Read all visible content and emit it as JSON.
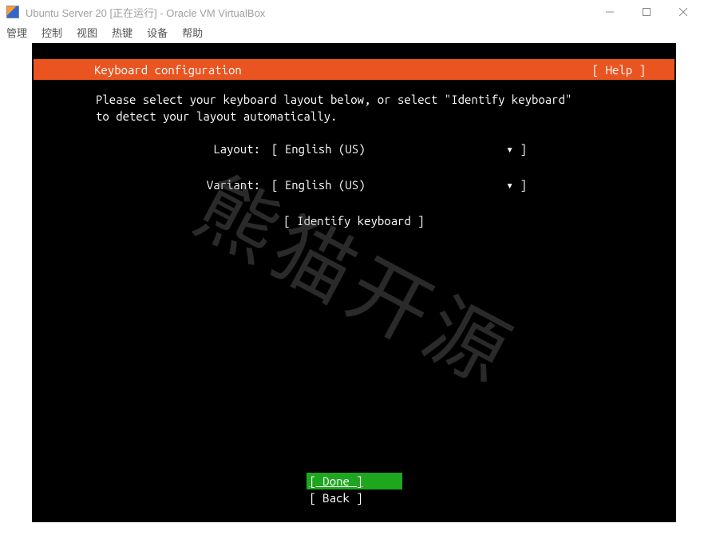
{
  "window": {
    "title": "Ubuntu Server 20 [正在运行] - Oracle VM VirtualBox"
  },
  "menu": {
    "items": [
      "管理",
      "控制",
      "视图",
      "热键",
      "设备",
      "帮助"
    ]
  },
  "header": {
    "title": "Keyboard configuration",
    "help": "[ Help ]"
  },
  "body": {
    "instructions": "Please select your keyboard layout below, or select \"Identify keyboard\" to detect your layout automatically.",
    "layout_label": "Layout:",
    "layout_value": "[ English (US)",
    "layout_caret": "▾ ]",
    "variant_label": "Variant:",
    "variant_value": "[ English (US)",
    "variant_caret": "▾ ]",
    "identify": "[ Identify keyboard ]"
  },
  "footer": {
    "done": "[ Done           ]",
    "back": "[ Back           ]"
  },
  "watermark": "熊猫开源"
}
